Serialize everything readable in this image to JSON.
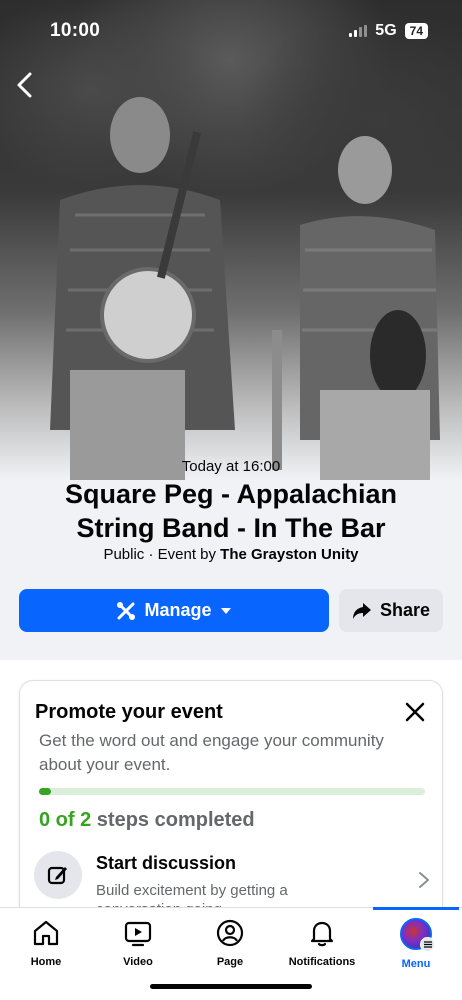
{
  "status_bar": {
    "time": "10:00",
    "network": "5G",
    "battery": "74"
  },
  "event": {
    "when": "Today at 16:00",
    "title": "Square Peg - Appalachian String Band - In The Bar",
    "privacy_prefix": "Public · Event by ",
    "host": "The Grayston Unity"
  },
  "actions": {
    "manage_label": "Manage",
    "share_label": "Share"
  },
  "promo": {
    "title": "Promote your event",
    "description": "Get the word out and engage your community about your event.",
    "progress_fraction": 0.03,
    "steps_count": "0 of 2",
    "steps_suffix": " steps completed",
    "task": {
      "title": "Start discussion",
      "description": "Build excitement by getting a conversation going"
    }
  },
  "tabs": [
    {
      "label": "Home",
      "icon": "home-icon"
    },
    {
      "label": "Video",
      "icon": "video-icon"
    },
    {
      "label": "Page",
      "icon": "page-icon"
    },
    {
      "label": "Notifications",
      "icon": "bell-icon"
    },
    {
      "label": "Menu",
      "icon": "avatar-icon",
      "active": true
    }
  ],
  "colors": {
    "accent": "#0866ff",
    "success": "#36a420",
    "secondary_text": "#65676b"
  }
}
